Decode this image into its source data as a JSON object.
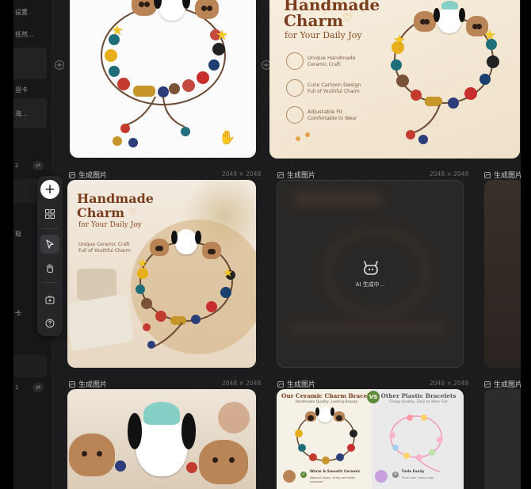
{
  "sidebar": {
    "items": [
      "设置",
      "任然...",
      "",
      "竖卡",
      "海..."
    ],
    "page_indicator": "2",
    "lower_items": [
      "现",
      "卡"
    ],
    "page_indicator_2": "1"
  },
  "toolbar": {
    "tools": [
      "add-icon",
      "grid-icon",
      "cursor-icon",
      "hand-icon",
      "media-icon",
      "help-icon"
    ]
  },
  "cards": [
    {
      "label": "生成图片",
      "dimensions": "2048 × 2048"
    },
    {
      "label": "生成图片",
      "dimensions": "2048 × 2048"
    },
    {
      "label": "生成图片"
    },
    {
      "label": "生成图片",
      "dimensions": "2048 × 2048"
    },
    {
      "label": "生成图片",
      "dimensions": "2048 × 2048"
    },
    {
      "label": "生成图片"
    }
  ],
  "top_right_card": {
    "title_line1": "Handmade",
    "title_line2": "Charm",
    "subtitle": "for Your Daily Joy",
    "features": [
      {
        "title": "Unique Handmade",
        "desc": "Ceramic Craft"
      },
      {
        "title": "Cute Cartoon Design",
        "desc": "Full of Youthful Charm"
      },
      {
        "title": "Adjustable Fit",
        "desc": "Comfortable to Wear"
      }
    ]
  },
  "middle_card": {
    "title_line1": "Handmade",
    "title_line2": "Charm",
    "subtitle": "for Your Daily Joy",
    "desc_line1": "Unique Ceramic Craft",
    "desc_line2": "Full of Youthful Charm"
  },
  "generating": {
    "text": "AI 生成中..."
  },
  "compare_card": {
    "left_title": "Our Ceramic Charm Bracelet",
    "left_sub": "Handmade Quality, Lasting Beauty",
    "vs": "VS",
    "right_title": "Other Plastic Bracelets",
    "right_sub": "Cheap Quality, Easy to Wear Out",
    "left_feature": "Warm & Smooth Ceramic",
    "left_feature_desc": "Natural Glaze, shiny and fade-resistant",
    "right_feature": "Fade Easily",
    "right_feature_desc": "Plain look, loses color"
  },
  "colors": {
    "canvas_bg": "#1c1c1e",
    "accent": "#ffffff"
  }
}
